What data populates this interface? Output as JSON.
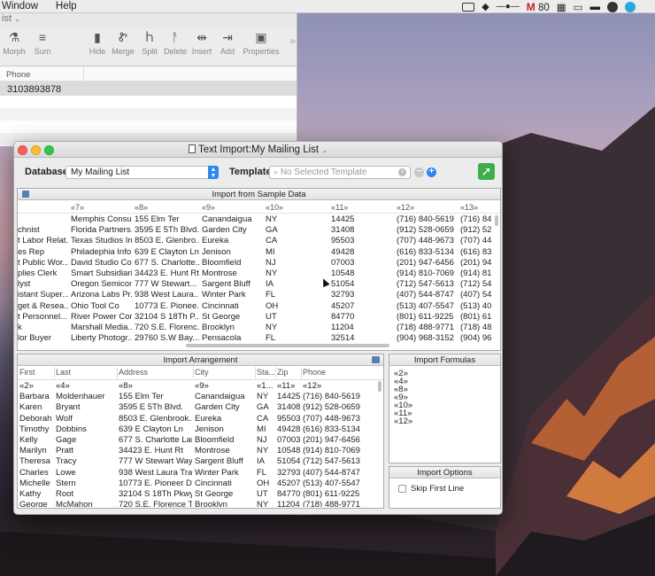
{
  "menubar": {
    "items": [
      "Window",
      "Help"
    ],
    "gmail_count": "80"
  },
  "bgwin": {
    "subtitle": "ist",
    "toolbar": [
      {
        "label": "Morph",
        "icon": "flask-icon",
        "glyph": "⚗"
      },
      {
        "label": "Sum",
        "icon": "sum-icon",
        "glyph": "≡"
      },
      {
        "label": "Hide",
        "icon": "bookmark-icon",
        "glyph": "▮"
      },
      {
        "label": "Merge",
        "icon": "merge-icon",
        "glyph": "Ꮡ"
      },
      {
        "label": "Split",
        "icon": "split-icon",
        "glyph": "Ⴙ"
      },
      {
        "label": "Delete",
        "icon": "delete-icon",
        "glyph": "ᚨ"
      },
      {
        "label": "Insert",
        "icon": "insert-icon",
        "glyph": "⇹"
      },
      {
        "label": "Add",
        "icon": "add-icon",
        "glyph": "⇥"
      },
      {
        "label": "Properties",
        "icon": "properties-icon",
        "glyph": "▣"
      }
    ],
    "column_header": "Phone",
    "first_value": "3103893878"
  },
  "dialog": {
    "title": "Text Import:My Mailing List",
    "database_label": "Database:",
    "database_value": "My Mailing List",
    "template_label": "Template:",
    "template_placeholder": "No Selected Template",
    "sample_title": "Import from Sample Data",
    "sample_columns": [
      "«7»",
      "«8»",
      "«9»",
      "«10»",
      "«11»",
      "«12»",
      "«13»"
    ],
    "sample_rows": [
      [
        "",
        "Memphis Consul...",
        "155 Elm Ter",
        "Canandaigua",
        "NY",
        "14425",
        "(716) 840-5619",
        "(716) 84"
      ],
      [
        "chnist",
        "Florida Partners...",
        "3595 E 5Th Blvd.",
        "Garden City",
        "GA",
        "31408",
        "(912) 528-0659",
        "(912) 52"
      ],
      [
        "t Labor Relat...",
        "Texas Studios In...",
        "8503 E. Glenbro...",
        "Eureka",
        "CA",
        "95503",
        "(707) 448-9673",
        "(707) 44"
      ],
      [
        "es Rep",
        "Philadephia Info...",
        "639 E Clayton Ln",
        "Jenison",
        "MI",
        "49428",
        "(616) 833-5134",
        "(616) 83"
      ],
      [
        "t Public Wor...",
        "David Studio Co.",
        "677 S. Charlotte...",
        "Bloomfield",
        "NJ",
        "07003",
        "(201) 947-6456",
        "(201) 94"
      ],
      [
        "plies Clerk",
        "Smart Subsidiari...",
        "34423 E. Hunt Rt",
        "Montrose",
        "NY",
        "10548",
        "(914) 810-7069",
        "(914) 81"
      ],
      [
        "lyst",
        "Oregon Semicon...",
        "777 W Stewart...",
        "Sargent Bluff",
        "IA",
        "51054",
        "(712) 547-5613",
        "(712) 54"
      ],
      [
        "istant Super...",
        "Arizona Labs Pr...",
        "938 West Laura...",
        "Winter Park",
        "FL",
        "32793",
        "(407) 544-8747",
        "(407) 54"
      ],
      [
        "get & Resea...",
        "Ohio Tool Co",
        "10773 E. Pionee...",
        "Cincinnati",
        "OH",
        "45207",
        "(513) 407-5547",
        "(513) 40"
      ],
      [
        "t Personnel...",
        "River Power Corp.",
        "32104 S 18Th P...",
        "St George",
        "UT",
        "84770",
        "(801) 611-9225",
        "(801) 61"
      ],
      [
        "k",
        "Marshall Media...",
        "720 S.E. Florenc...",
        "Brooklyn",
        "NY",
        "11204",
        "(718) 488-9771",
        "(718) 48"
      ],
      [
        "lor Buyer",
        "Liberty Photogr...",
        "29760 S.W Bay...",
        "Pensacola",
        "FL",
        "32514",
        "(904) 968-3152",
        "(904) 96"
      ]
    ],
    "arrangement_title": "Import Arrangement",
    "arrangement_columns": [
      "First",
      "Last",
      "Address",
      "City",
      "Sta...",
      "Zip",
      "Phone"
    ],
    "arrangement_formulas": [
      "«2»",
      "«4»",
      "«8»",
      "«9»",
      "«1...",
      "«11»",
      "«12»"
    ],
    "arrangement_rows": [
      [
        "Barbara",
        "Moldenhauer",
        "155 Elm Ter",
        "Canandaigua",
        "NY",
        "14425",
        "(716) 840-5619"
      ],
      [
        "Karen",
        "Bryant",
        "3595 E 5Th Blvd.",
        "Garden City",
        "GA",
        "31408",
        "(912) 528-0659"
      ],
      [
        "Deborah",
        "Wolf",
        "8503 E. Glenbrook...",
        "Eureka",
        "CA",
        "95503",
        "(707) 448-9673"
      ],
      [
        "Timothy",
        "Dobbins",
        "639 E Clayton Ln",
        "Jenison",
        "MI",
        "49428",
        "(616) 833-5134"
      ],
      [
        "Kelly",
        "Gage",
        "677 S. Charlotte Lane",
        "Bloomfield",
        "NJ",
        "07003",
        "(201) 947-6456"
      ],
      [
        "Marilyn",
        "Pratt",
        "34423 E. Hunt Rt",
        "Montrose",
        "NY",
        "10548",
        "(914) 810-7069"
      ],
      [
        "Theresa",
        "Tracy",
        "777 W Stewart Way",
        "Sargent Bluff",
        "IA",
        "51054",
        "(712) 547-5613"
      ],
      [
        "Charles",
        "Lowe",
        "938 West Laura Trail",
        "Winter Park",
        "FL",
        "32793",
        "(407) 544-8747"
      ],
      [
        "Michelle",
        "Stern",
        "10773 E. Pioneer Dr",
        "Cincinnati",
        "OH",
        "45207",
        "(513) 407-5547"
      ],
      [
        "Kathy",
        "Root",
        "32104 S 18Th Pkwy",
        "St George",
        "UT",
        "84770",
        "(801) 611-9225"
      ],
      [
        "George",
        "McMahon",
        "720 S.E. Florence Ter",
        "Brooklyn",
        "NY",
        "11204",
        "(718) 488-9771"
      ]
    ],
    "formulas_title": "Import Formulas",
    "formulas": [
      "«2»",
      "«4»",
      "«8»",
      "«9»",
      "«10»",
      "«11»",
      "«12»"
    ],
    "options_title": "Import Options",
    "skip_first_line": "Skip First Line",
    "skip_checked": false
  }
}
